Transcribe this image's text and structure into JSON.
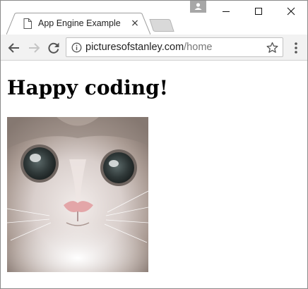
{
  "tab": {
    "title": "App Engine Example",
    "icon": "page-icon",
    "close_label": "×"
  },
  "window_controls": [
    "minimize-icon",
    "maximize-icon",
    "close-icon"
  ],
  "toolbar": {
    "back_icon": "back-arrow-icon",
    "forward_icon": "forward-arrow-icon",
    "reload_icon": "reload-icon",
    "url_host": "picturesofstanley.com",
    "url_path": "/home",
    "bookmark_icon": "star-icon",
    "menu_icon": "more-vert-icon"
  },
  "page": {
    "heading": "Happy coding!",
    "image": "cat-photo"
  }
}
